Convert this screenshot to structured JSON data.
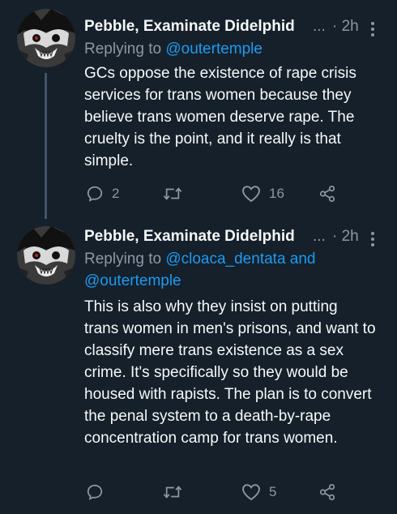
{
  "tweets": [
    {
      "author": "Pebble, Examinate Didelphid",
      "truncation": "...",
      "time": "· 2h",
      "replying_prefix": "Replying to",
      "replying_line1": "@outertemple",
      "replying_line2": "",
      "text": "GCs oppose the existence of rape crisis services for trans women because they believe trans women deserve rape. The cruelty is the point, and it really is that simple.",
      "replies": "2",
      "retweets": "",
      "likes": "16"
    },
    {
      "author": "Pebble, Examinate Didelphid",
      "truncation": "...",
      "time": "· 2h",
      "replying_prefix": "Replying to",
      "replying_line1": "@cloaca_dentata and",
      "replying_line2": "@outertemple",
      "text": "This is also why they insist on putting trans women in men's prisons, and want to classify mere trans existence as a sex crime. It's specifically so they would be housed with rapists. The plan is to convert the penal system to a death-by-rape concentration camp for trans women.",
      "replies": "",
      "retweets": "",
      "likes": "5"
    }
  ],
  "colors": {
    "background": "#15202b",
    "text": "#f7f9f9",
    "secondary": "#8b98a5",
    "link": "#1d9bf0",
    "thread_line": "#425466"
  },
  "icons": [
    "avatar-opossum",
    "more-icon",
    "reply-icon",
    "retweet-icon",
    "like-icon",
    "share-icon"
  ]
}
